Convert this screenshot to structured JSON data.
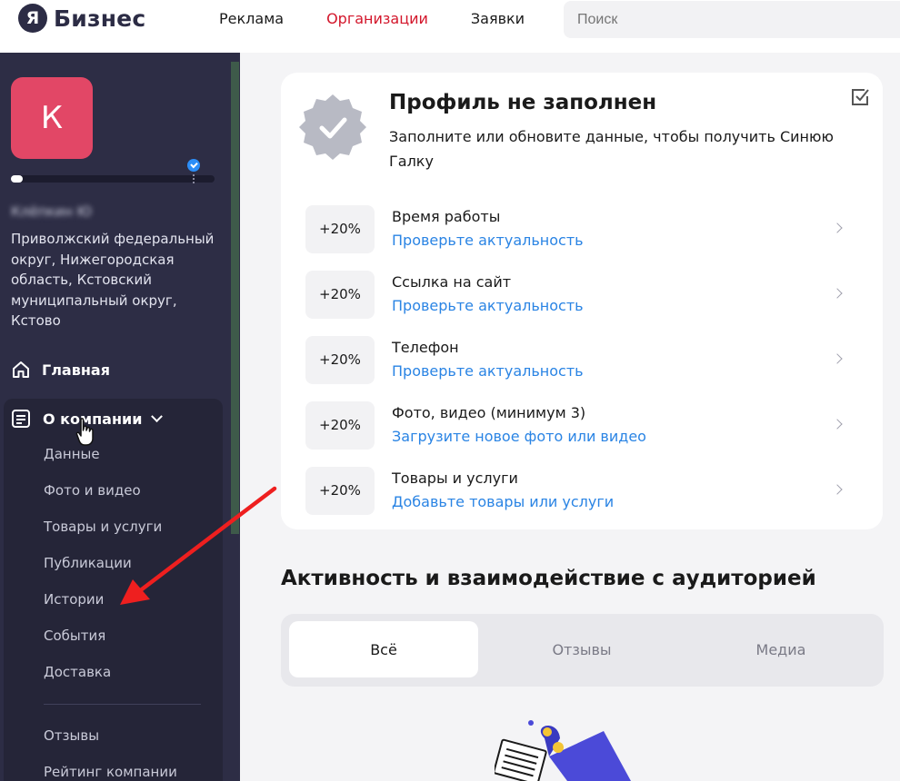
{
  "header": {
    "logo_letter": "Я",
    "logo_text": "Бизнес",
    "nav": [
      {
        "label": "Реклама",
        "active": false
      },
      {
        "label": "Организации",
        "active": true
      },
      {
        "label": "Заявки",
        "active": false
      }
    ],
    "search_placeholder": "Поиск",
    "active_color": "#d3162b"
  },
  "sidebar": {
    "avatar_letter": "К",
    "avatar_color": "#e24766",
    "profile_progress": 0.04,
    "company_name_blurred": "Клёпкин Ю",
    "address": "Приволжский федеральный округ, Нижегородская область, Кстовский муниципальный округ, Кстово",
    "main_item": "Главная",
    "about_item": "О компании",
    "about_subitems": [
      "Данные",
      "Фото и видео",
      "Товары и услуги",
      "Публикации",
      "Истории",
      "События",
      "Доставка"
    ],
    "other_items": [
      "Отзывы",
      "Рейтинг компании"
    ]
  },
  "profile_card": {
    "title": "Профиль не заполнен",
    "subtitle": "Заполните или обновите данные, чтобы получить Синюю Галку",
    "rows": [
      {
        "percent": "+20%",
        "title": "Время работы",
        "link": "Проверьте актуальность"
      },
      {
        "percent": "+20%",
        "title": "Ссылка на сайт",
        "link": "Проверьте актуальность"
      },
      {
        "percent": "+20%",
        "title": "Телефон",
        "link": "Проверьте актуальность"
      },
      {
        "percent": "+20%",
        "title": "Фото, видео (минимум 3)",
        "link": "Загрузите новое фото или видео"
      },
      {
        "percent": "+20%",
        "title": "Товары и услуги",
        "link": "Добавьте товары или услуги"
      }
    ],
    "link_color": "#2a84e4"
  },
  "activity": {
    "title": "Активность и взаимодействие с аудиторией",
    "tabs": [
      {
        "label": "Всё",
        "active": true
      },
      {
        "label": "Отзывы",
        "active": false
      },
      {
        "label": "Медиа",
        "active": false
      }
    ]
  }
}
